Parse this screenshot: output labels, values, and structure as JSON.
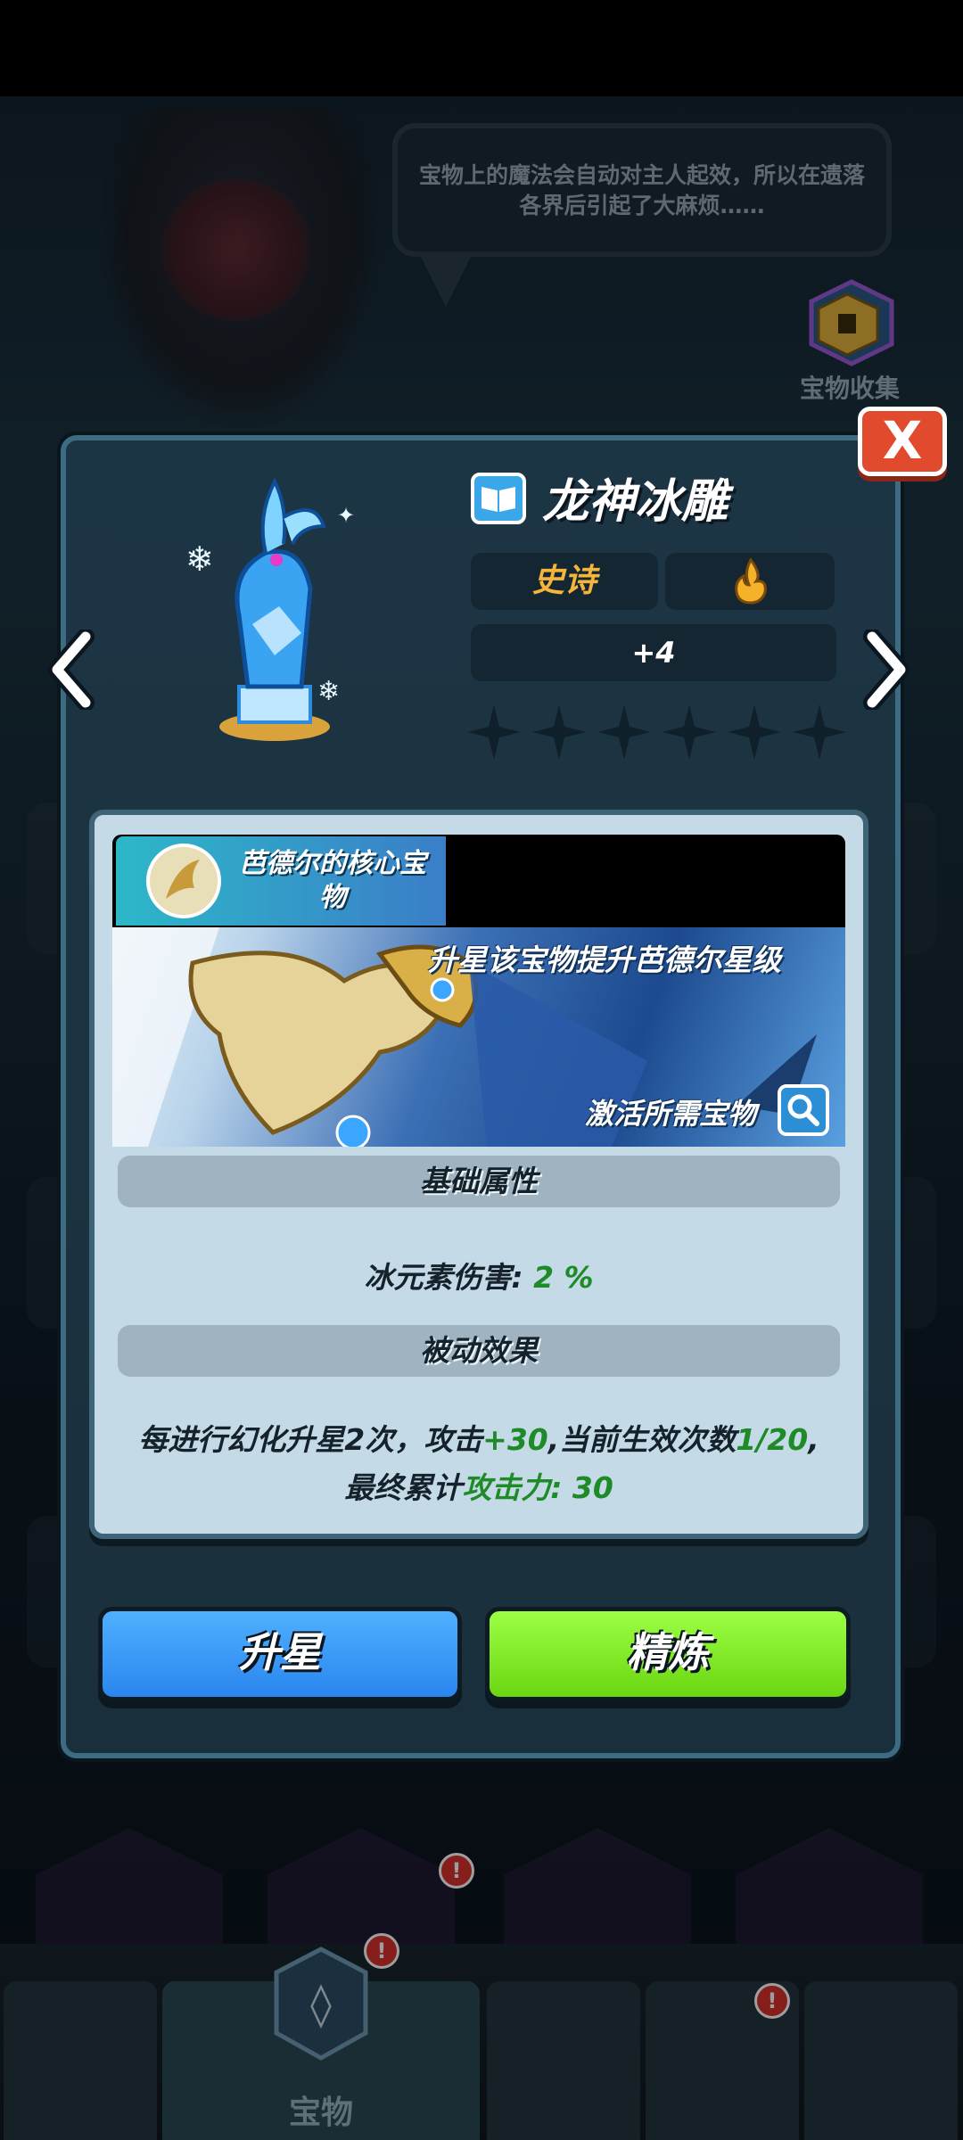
{
  "background": {
    "speech_text": "宝物上的魔法会自动对主人起效，所以在遗落各界后引起了大麻烦……",
    "collection_label": "宝物收集"
  },
  "dialog": {
    "close_label": "X",
    "item": {
      "name": "龙神冰雕",
      "rarity": "史诗",
      "level": "+4",
      "star_count_filled": 0,
      "star_count_total": 6
    },
    "core": {
      "label": "芭德尔的核心宝物",
      "banner_title": "升星该宝物提升芭德尔星级",
      "banner_link": "激活所需宝物"
    },
    "base_stats": {
      "header": "基础属性",
      "label": "冰元素伤害:",
      "value": "2 %"
    },
    "passive": {
      "header": "被动效果",
      "line1_a": "每进行幻化升星2次，攻击",
      "line1_b": "+30",
      "line1_c": ",当前生效次数",
      "line1_d": "1/20",
      "line1_e": ",",
      "line2_a": "最终累计",
      "line2_b": "攻击力: 30"
    },
    "buttons": {
      "star_up": "升星",
      "refine": "精炼"
    }
  },
  "nav": {
    "active_label": "宝物",
    "badge": "!"
  },
  "colors": {
    "rarity": "#f5b43a",
    "accent_green": "#1e8a28",
    "star_btn": "#2a86ee",
    "refine_btn": "#6bd611",
    "close_btn": "#e14a2c"
  }
}
